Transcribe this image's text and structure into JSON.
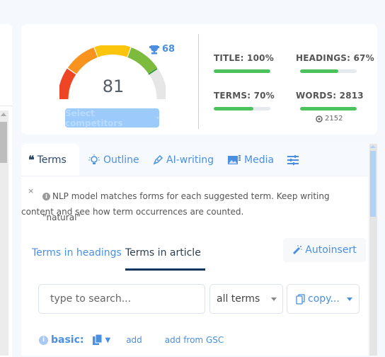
{
  "score": {
    "value": "81",
    "target_score": "68",
    "gauge_fraction": 0.81,
    "select_competitors_label": "Select competitors",
    "gauge_colors": [
      "#ee4624",
      "#f7931e",
      "#fcc50d",
      "#7dbb3f",
      "#e6e6e6"
    ]
  },
  "metrics": {
    "title": {
      "label": "TITLE: 100%",
      "fraction": 1.0
    },
    "headings": {
      "label": "HEADINGS: 67%",
      "fraction": 0.67
    },
    "terms": {
      "label": "TERMS: 70%",
      "fraction": 0.7
    },
    "words": {
      "label": "WORDS: 2813",
      "fraction": 1.0,
      "target": "2152"
    }
  },
  "tabs": [
    {
      "label": "Terms",
      "icon": "quote-icon",
      "active": true
    },
    {
      "label": "Outline",
      "icon": "lightbulb-icon"
    },
    {
      "label": "AI-writing",
      "icon": "pen-icon"
    },
    {
      "label": "Media",
      "icon": "image-icon"
    },
    {
      "label": "",
      "icon": "sliders-icon"
    }
  ],
  "notice": {
    "close": "×",
    "line1": "NLP model matches forms for each suggested term. Keep writing \"natural\"",
    "line2": "content and see how term occurrences are counted."
  },
  "subtabs": {
    "headings": "Terms in headings",
    "article": "Terms in article",
    "autoinsert": "Autoinsert"
  },
  "search": {
    "placeholder": "type to search..."
  },
  "filter": {
    "selected": "all terms"
  },
  "copy": {
    "label": "copy..."
  },
  "basic": {
    "label": "basic:",
    "add": "add",
    "add_gsc": "add from GSC"
  },
  "colors": {
    "accent": "#4a8fe0",
    "bar_green": "#4cc25c",
    "dark_navy": "#12355f"
  }
}
